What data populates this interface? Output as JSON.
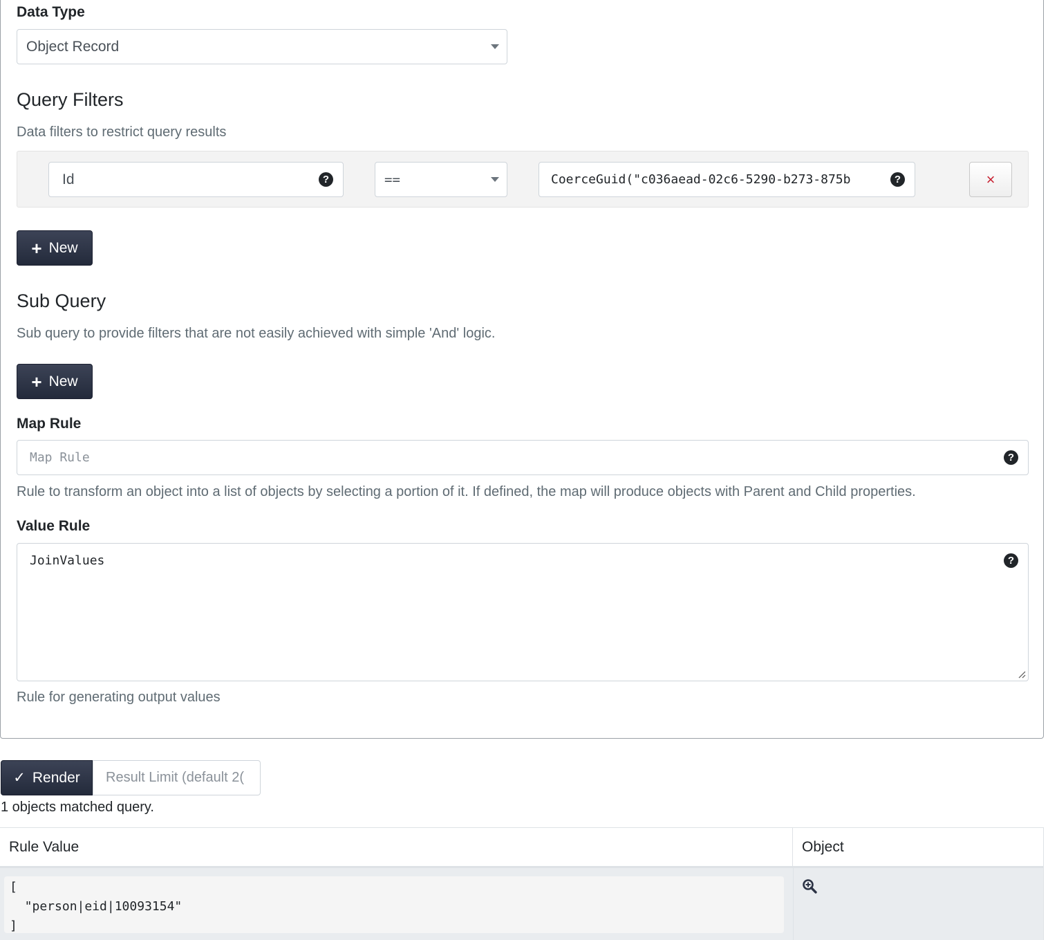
{
  "data_type": {
    "label": "Data Type",
    "value": "Object Record"
  },
  "query_filters": {
    "title": "Query Filters",
    "description": "Data filters to restrict query results",
    "rows": [
      {
        "field": "Id",
        "operator": "==",
        "value": "CoerceGuid(\"c036aead-02c6-5290-b273-875b"
      }
    ],
    "remove_symbol": "×",
    "new_label": "New"
  },
  "sub_query": {
    "title": "Sub Query",
    "description": "Sub query to provide filters that are not easily achieved with simple 'And' logic.",
    "new_label": "New"
  },
  "map_rule": {
    "label": "Map Rule",
    "placeholder": "Map Rule",
    "value": "",
    "description": "Rule to transform an object into a list of objects by selecting a portion of it. If defined, the map will produce objects with Parent and Child properties."
  },
  "value_rule": {
    "label": "Value Rule",
    "value": "JoinValues",
    "description": "Rule for generating output values"
  },
  "render": {
    "label": "Render",
    "check_symbol": "✓",
    "result_limit_placeholder": "Result Limit (default 2("
  },
  "result": {
    "summary": "1 objects matched query.",
    "columns": [
      "Rule Value",
      "Object"
    ],
    "rows": [
      {
        "rule_value": "[\n  \"person|eid|10093154\"\n]"
      }
    ]
  },
  "icons": {
    "help": "question-circle-icon",
    "dropdown": "caret-down-icon",
    "plus": "plus-icon",
    "zoom": "zoom-in-icon"
  },
  "colors": {
    "button_dark": "#2c3345",
    "remove_red": "#c82333",
    "muted_text": "#5f6b73"
  }
}
